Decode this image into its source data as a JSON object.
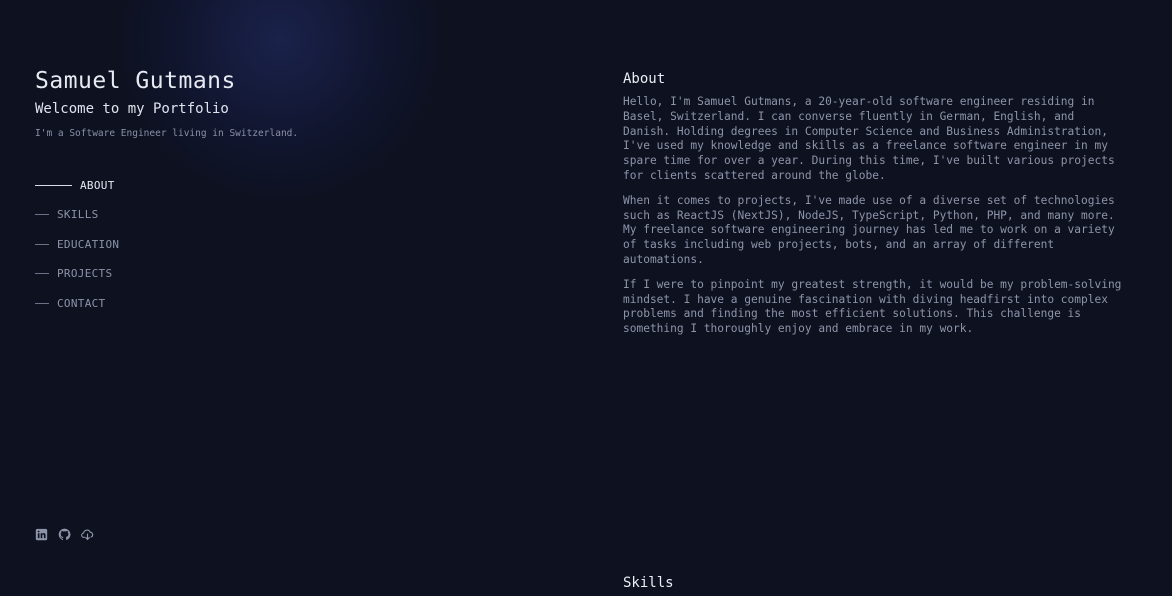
{
  "profile": {
    "name": "Samuel Gutmans",
    "subtitle": "Welcome to my Portfolio",
    "tagline": "I'm a Software Engineer living in Switzerland."
  },
  "nav": {
    "items": [
      {
        "label": "ABOUT",
        "active": true
      },
      {
        "label": "SKILLS",
        "active": false
      },
      {
        "label": "EDUCATION",
        "active": false
      },
      {
        "label": "PROJECTS",
        "active": false
      },
      {
        "label": "CONTACT",
        "active": false
      }
    ]
  },
  "social": {
    "icons": [
      "linkedin-icon",
      "github-icon",
      "cloud-download-icon"
    ]
  },
  "about": {
    "title": "About",
    "paragraphs": [
      "Hello, I'm Samuel Gutmans, a 20-year-old software engineer residing in Basel, Switzerland. I can converse fluently in German, English, and Danish. Holding degrees in Computer Science and Business Administration, I've used my knowledge and skills as a freelance software engineer in my spare time for over a year. During this time, I've built various projects for clients scattered around the globe.",
      "When it comes to projects, I've made use of a diverse set of technologies such as ReactJS (NextJS), NodeJS, TypeScript, Python, PHP, and many more. My freelance software engineering journey has led me to work on a variety of tasks including web projects, bots, and an array of different automations.",
      "If I were to pinpoint my greatest strength, it would be my problem-solving mindset. I have a genuine fascination with diving headfirst into complex problems and finding the most efficient solutions. This challenge is something I thoroughly enjoy and embrace in my work."
    ]
  },
  "skills": {
    "title": "Skills"
  },
  "colors": {
    "background": "#0d1120",
    "accent": "#e8eaf2",
    "muted_text": "#8e95a9"
  }
}
